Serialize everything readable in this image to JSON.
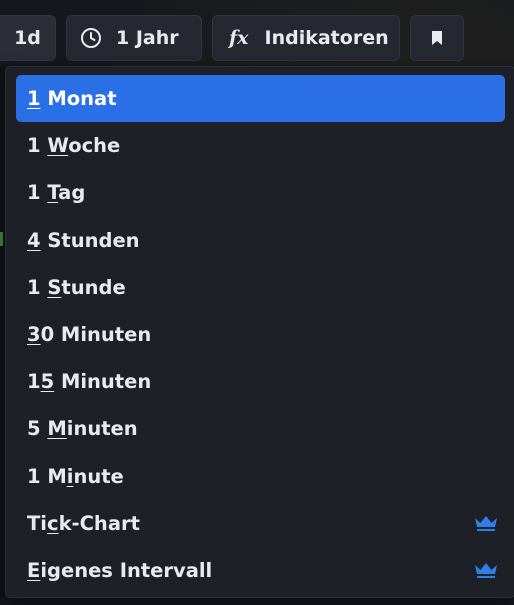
{
  "toolbar": {
    "interval_label": "1d",
    "range_label": "1 Jahr",
    "indicators_fx": "fx",
    "indicators_label": "Indikatoren"
  },
  "interval_menu": {
    "items": [
      {
        "pre": "",
        "u": "1",
        "post": " Monat",
        "selected": true,
        "premium": false
      },
      {
        "pre": "1 ",
        "u": "W",
        "post": "oche",
        "selected": false,
        "premium": false
      },
      {
        "pre": "1 ",
        "u": "T",
        "post": "ag",
        "selected": false,
        "premium": false
      },
      {
        "pre": "",
        "u": "4",
        "post": " Stunden",
        "selected": false,
        "premium": false
      },
      {
        "pre": "1 ",
        "u": "S",
        "post": "tunde",
        "selected": false,
        "premium": false
      },
      {
        "pre": "",
        "u": "3",
        "post": "0 Minuten",
        "selected": false,
        "premium": false
      },
      {
        "pre": "1",
        "u": "5",
        "post": " Minuten",
        "selected": false,
        "premium": false
      },
      {
        "pre": "5 ",
        "u": "M",
        "post": "inuten",
        "selected": false,
        "premium": false
      },
      {
        "pre": "1 M",
        "u": "i",
        "post": "nute",
        "selected": false,
        "premium": false
      },
      {
        "pre": "Ti",
        "u": "c",
        "post": "k-Chart",
        "selected": false,
        "premium": true
      },
      {
        "pre": "",
        "u": "E",
        "post": "igenes Intervall",
        "selected": false,
        "premium": true
      }
    ]
  },
  "colors": {
    "accent": "#2a6fe6",
    "crown": "#2f7fe8"
  }
}
